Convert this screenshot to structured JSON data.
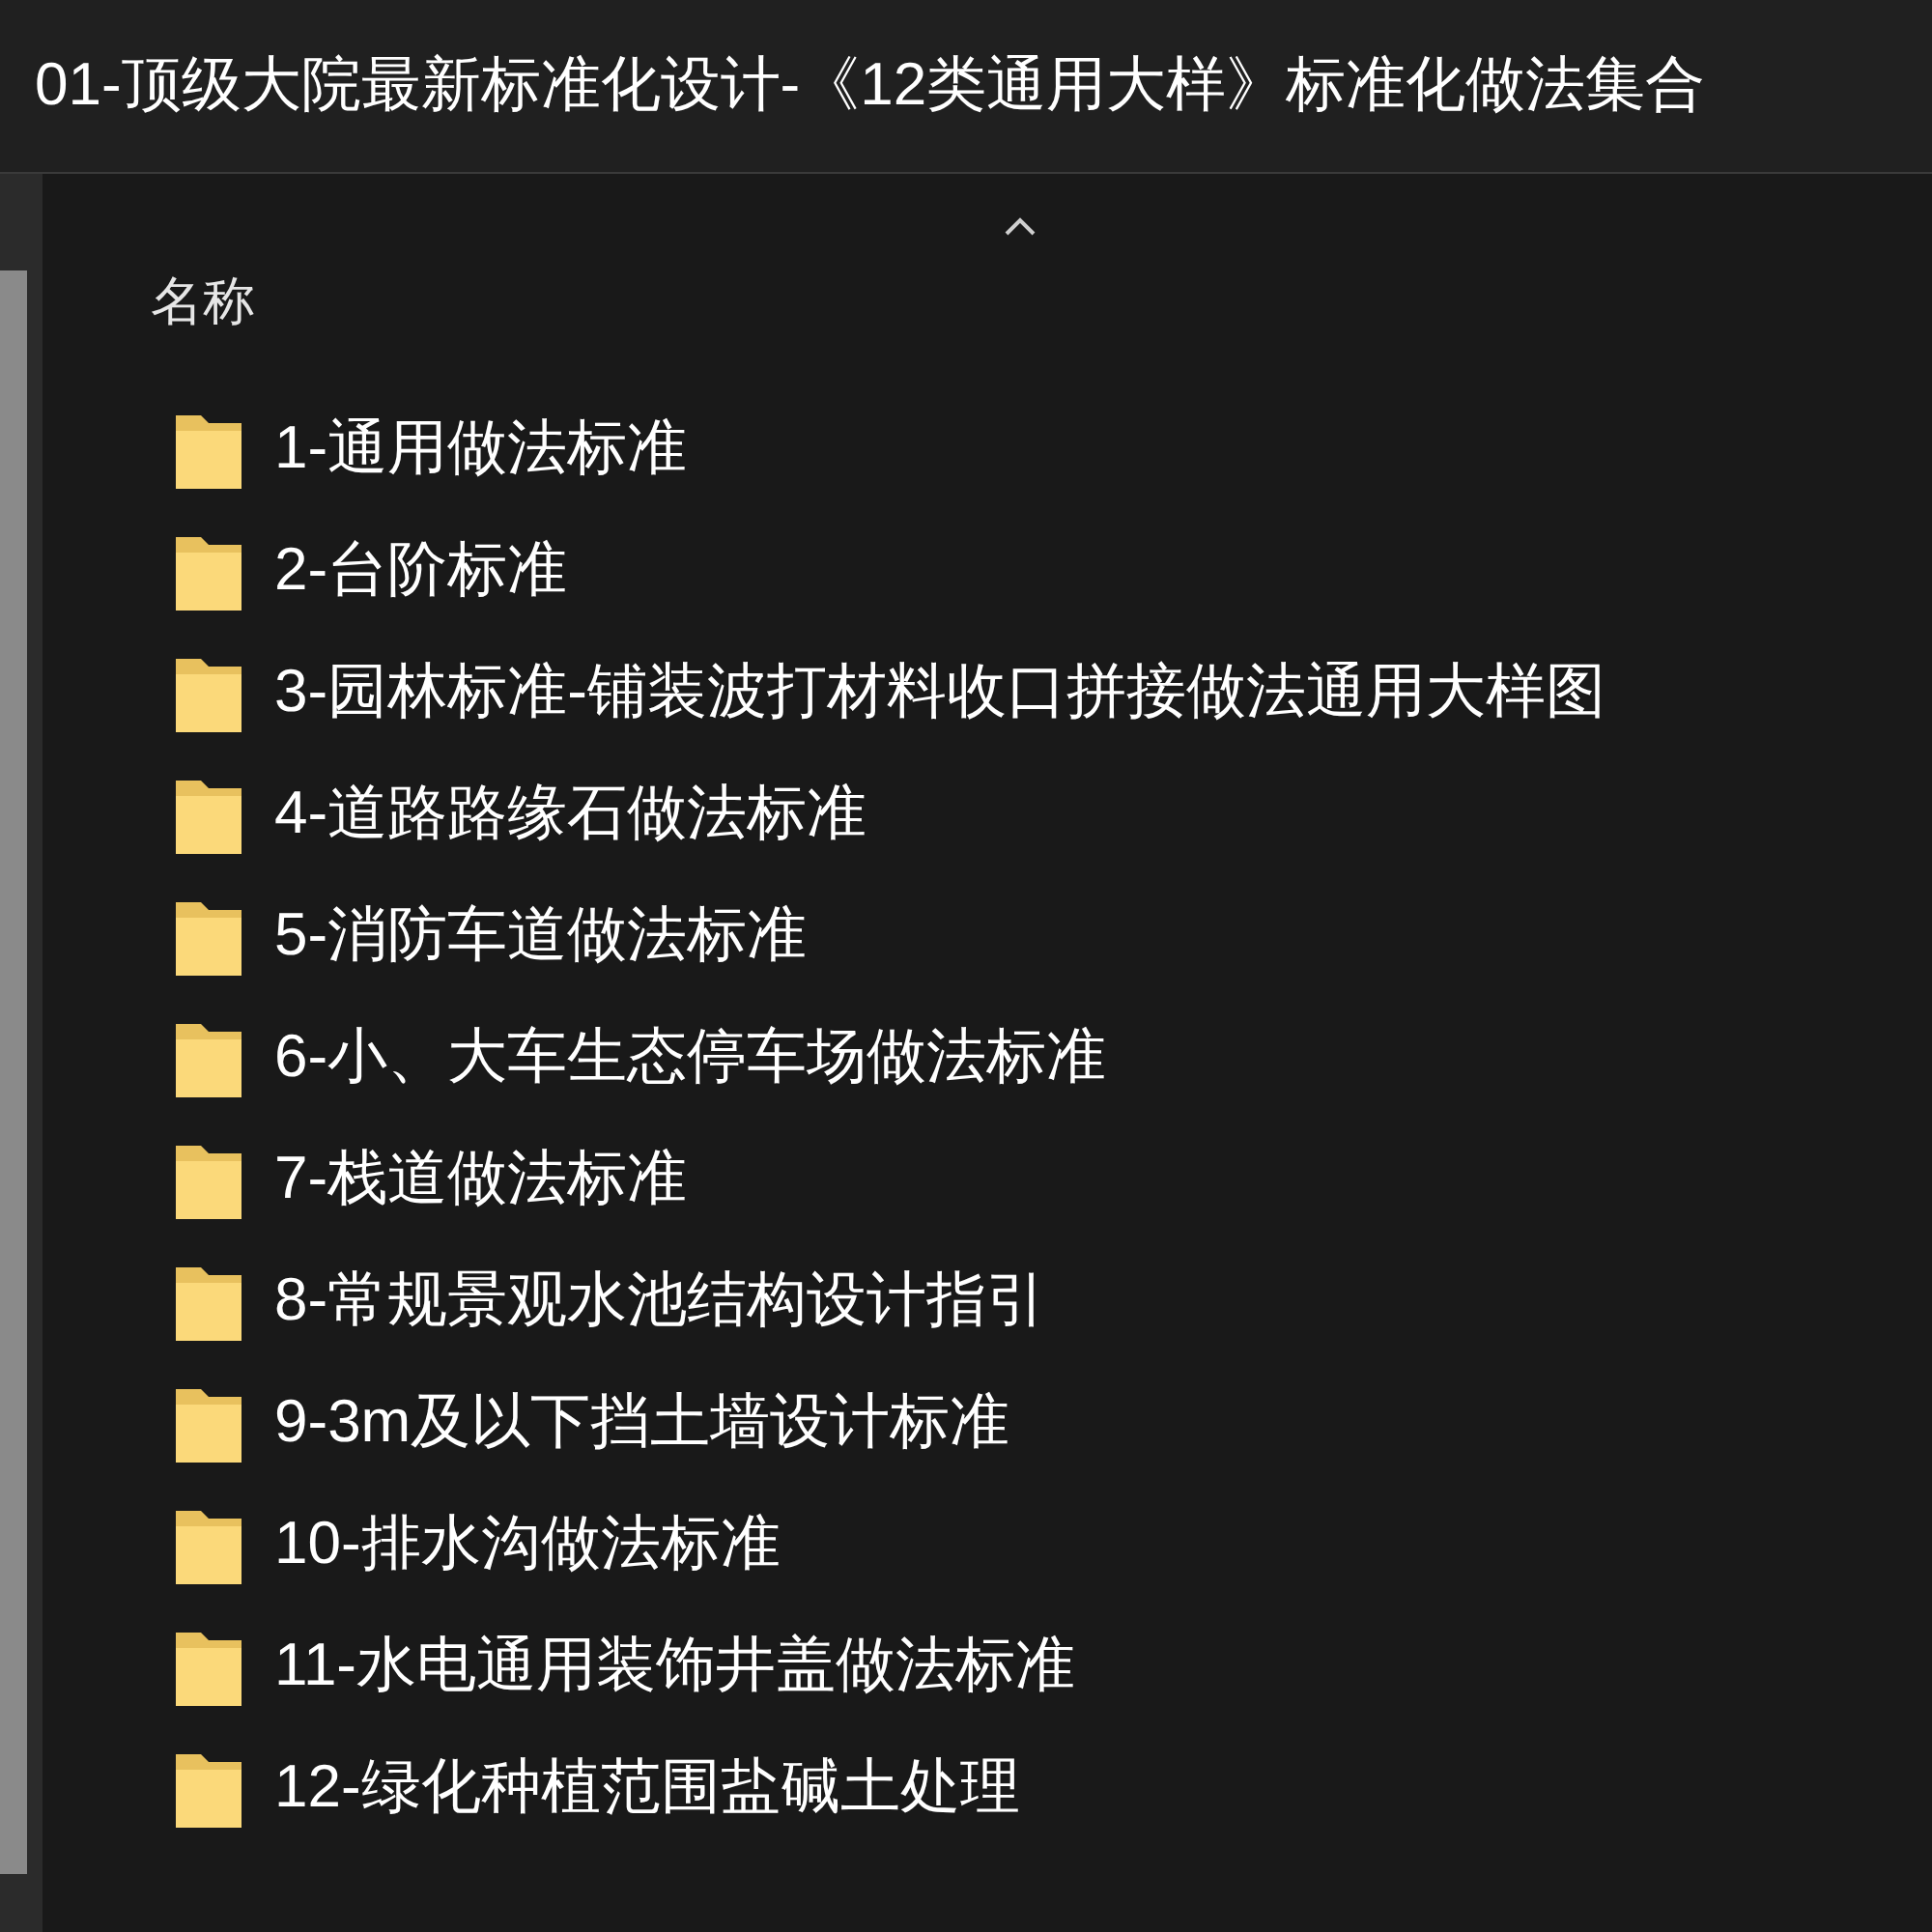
{
  "window": {
    "title": "01-顶级大院最新标准化设计-《12类通用大样》标准化做法集合"
  },
  "list": {
    "column": "名称",
    "sort_ascending": true,
    "items": [
      {
        "name": "1-通用做法标准",
        "kind": "folder"
      },
      {
        "name": "2-台阶标准",
        "kind": "folder"
      },
      {
        "name": "3-园林标准-铺装波打材料收口拼接做法通用大样图",
        "kind": "folder"
      },
      {
        "name": "4-道路路缘石做法标准",
        "kind": "folder"
      },
      {
        "name": "5-消防车道做法标准",
        "kind": "folder"
      },
      {
        "name": "6-小、大车生态停车场做法标准",
        "kind": "folder"
      },
      {
        "name": "7-栈道做法标准",
        "kind": "folder"
      },
      {
        "name": "8-常规景观水池结构设计指引",
        "kind": "folder"
      },
      {
        "name": "9-3m及以下挡土墙设计标准",
        "kind": "folder"
      },
      {
        "name": "10-排水沟做法标准",
        "kind": "folder"
      },
      {
        "name": "11-水电通用装饰井盖做法标准",
        "kind": "folder"
      },
      {
        "name": "12-绿化种植范围盐碱土处理",
        "kind": "folder"
      }
    ]
  }
}
